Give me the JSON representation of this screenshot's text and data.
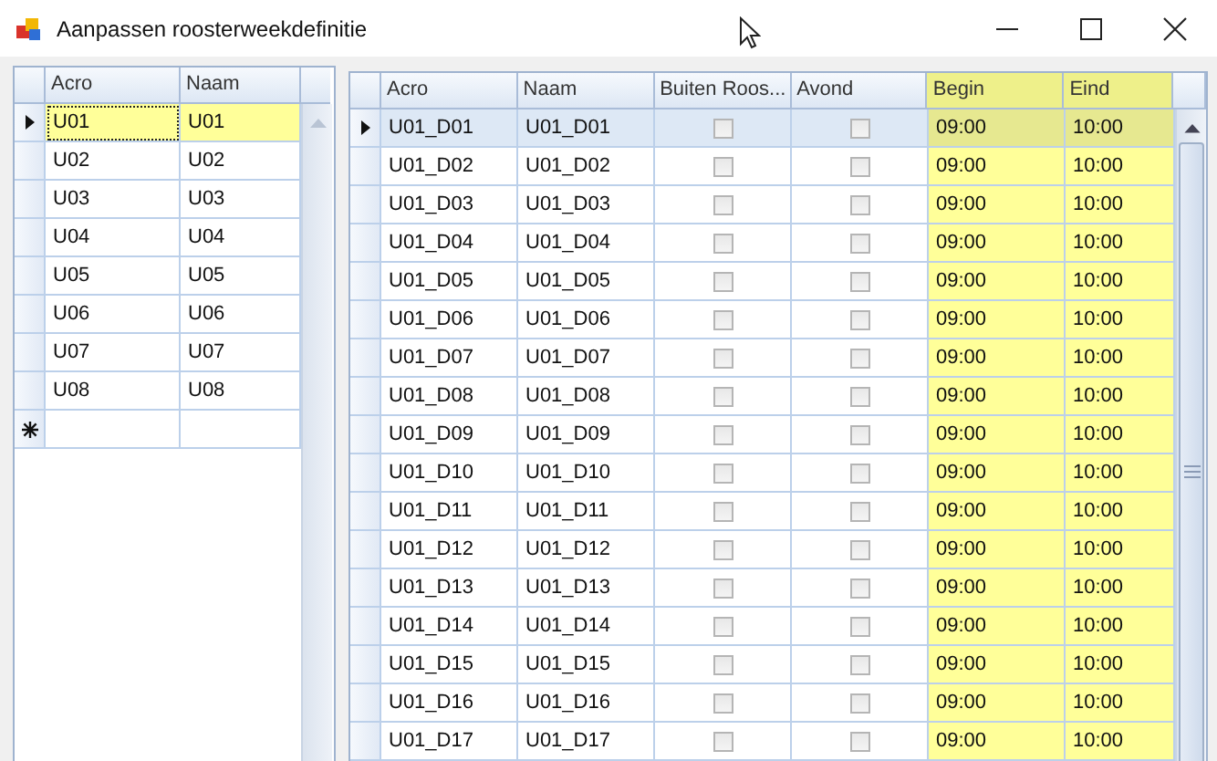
{
  "window": {
    "title": "Aanpassen roosterweekdefinitie"
  },
  "left_grid": {
    "columns": [
      "Acro",
      "Naam"
    ],
    "rows": [
      {
        "acro": "U01",
        "naam": "U01",
        "selected": true
      },
      {
        "acro": "U02",
        "naam": "U02",
        "selected": false
      },
      {
        "acro": "U03",
        "naam": "U03",
        "selected": false
      },
      {
        "acro": "U04",
        "naam": "U04",
        "selected": false
      },
      {
        "acro": "U05",
        "naam": "U05",
        "selected": false
      },
      {
        "acro": "U06",
        "naam": "U06",
        "selected": false
      },
      {
        "acro": "U07",
        "naam": "U07",
        "selected": false
      },
      {
        "acro": "U08",
        "naam": "U08",
        "selected": false
      }
    ]
  },
  "right_grid": {
    "columns": [
      "Acro",
      "Naam",
      "Buiten Roos...",
      "Avond",
      "Begin",
      "Eind"
    ],
    "rows": [
      {
        "acro": "U01_D01",
        "naam": "U01_D01",
        "buiten_rooster": false,
        "avond": false,
        "begin": "09:00",
        "eind": "10:00",
        "selected": true
      },
      {
        "acro": "U01_D02",
        "naam": "U01_D02",
        "buiten_rooster": false,
        "avond": false,
        "begin": "09:00",
        "eind": "10:00",
        "selected": false
      },
      {
        "acro": "U01_D03",
        "naam": "U01_D03",
        "buiten_rooster": false,
        "avond": false,
        "begin": "09:00",
        "eind": "10:00",
        "selected": false
      },
      {
        "acro": "U01_D04",
        "naam": "U01_D04",
        "buiten_rooster": false,
        "avond": false,
        "begin": "09:00",
        "eind": "10:00",
        "selected": false
      },
      {
        "acro": "U01_D05",
        "naam": "U01_D05",
        "buiten_rooster": false,
        "avond": false,
        "begin": "09:00",
        "eind": "10:00",
        "selected": false
      },
      {
        "acro": "U01_D06",
        "naam": "U01_D06",
        "buiten_rooster": false,
        "avond": false,
        "begin": "09:00",
        "eind": "10:00",
        "selected": false
      },
      {
        "acro": "U01_D07",
        "naam": "U01_D07",
        "buiten_rooster": false,
        "avond": false,
        "begin": "09:00",
        "eind": "10:00",
        "selected": false
      },
      {
        "acro": "U01_D08",
        "naam": "U01_D08",
        "buiten_rooster": false,
        "avond": false,
        "begin": "09:00",
        "eind": "10:00",
        "selected": false
      },
      {
        "acro": "U01_D09",
        "naam": "U01_D09",
        "buiten_rooster": false,
        "avond": false,
        "begin": "09:00",
        "eind": "10:00",
        "selected": false
      },
      {
        "acro": "U01_D10",
        "naam": "U01_D10",
        "buiten_rooster": false,
        "avond": false,
        "begin": "09:00",
        "eind": "10:00",
        "selected": false
      },
      {
        "acro": "U01_D11",
        "naam": "U01_D11",
        "buiten_rooster": false,
        "avond": false,
        "begin": "09:00",
        "eind": "10:00",
        "selected": false
      },
      {
        "acro": "U01_D12",
        "naam": "U01_D12",
        "buiten_rooster": false,
        "avond": false,
        "begin": "09:00",
        "eind": "10:00",
        "selected": false
      },
      {
        "acro": "U01_D13",
        "naam": "U01_D13",
        "buiten_rooster": false,
        "avond": false,
        "begin": "09:00",
        "eind": "10:00",
        "selected": false
      },
      {
        "acro": "U01_D14",
        "naam": "U01_D14",
        "buiten_rooster": false,
        "avond": false,
        "begin": "09:00",
        "eind": "10:00",
        "selected": false
      },
      {
        "acro": "U01_D15",
        "naam": "U01_D15",
        "buiten_rooster": false,
        "avond": false,
        "begin": "09:00",
        "eind": "10:00",
        "selected": false
      },
      {
        "acro": "U01_D16",
        "naam": "U01_D16",
        "buiten_rooster": false,
        "avond": false,
        "begin": "09:00",
        "eind": "10:00",
        "selected": false
      },
      {
        "acro": "U01_D17",
        "naam": "U01_D17",
        "buiten_rooster": false,
        "avond": false,
        "begin": "09:00",
        "eind": "10:00",
        "selected": false
      }
    ]
  }
}
